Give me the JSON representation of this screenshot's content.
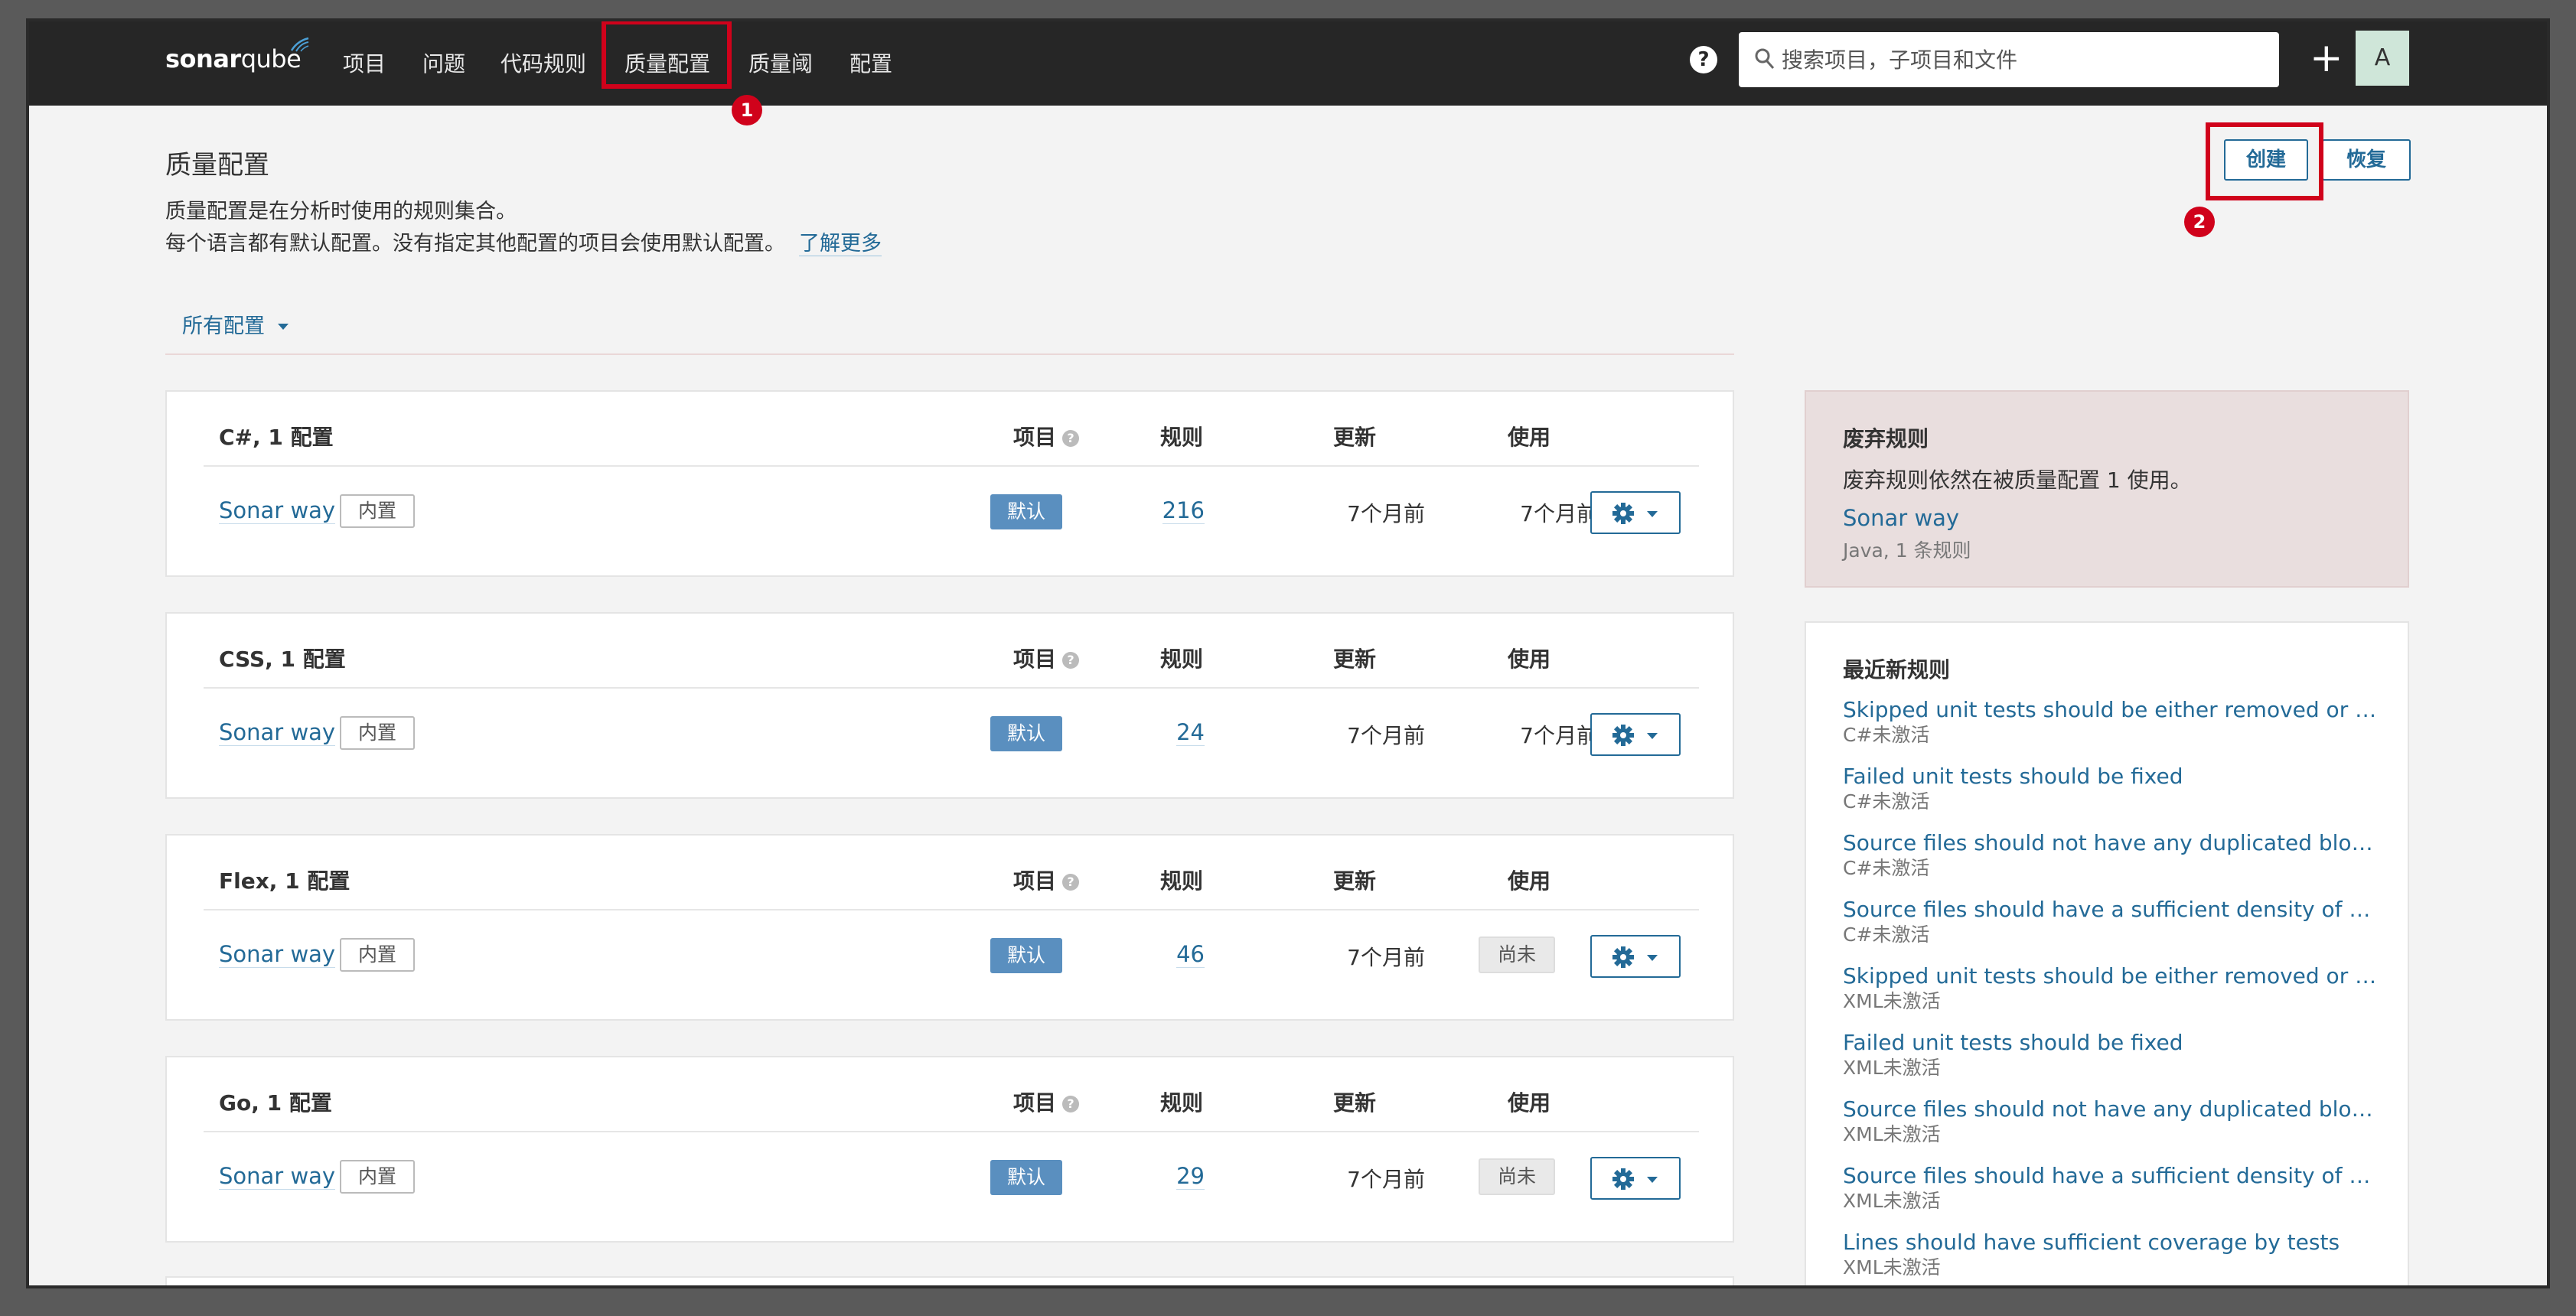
{
  "nav": {
    "logo_bold": "sonar",
    "logo_rest": "qube",
    "items": [
      "项目",
      "问题",
      "代码规则",
      "质量配置",
      "质量阈",
      "配置"
    ],
    "badge_1": "1",
    "help": "?",
    "search_placeholder": "搜索项目，子项目和文件",
    "plus": "+",
    "avatar": "A"
  },
  "header": {
    "title": "质量配置",
    "desc_line1": "质量配置是在分析时使用的规则集合。",
    "desc_line2": "每个语言都有默认配置。没有指定其他配置的项目会使用默认配置。",
    "learn_more": "了解更多",
    "create": "创建",
    "restore": "恢复",
    "badge_2": "2",
    "filter": "所有配置"
  },
  "columns": {
    "projects": "项目",
    "rules": "规则",
    "updated": "更新",
    "used": "使用"
  },
  "profiles": [
    {
      "lang": "C#, 1 配置",
      "name": "Sonar way",
      "builtin": "内置",
      "default": "默认",
      "rules": "216",
      "updated": "7个月前",
      "used": "7个月前",
      "used_tag": false
    },
    {
      "lang": "CSS, 1 配置",
      "name": "Sonar way",
      "builtin": "内置",
      "default": "默认",
      "rules": "24",
      "updated": "7个月前",
      "used": "7个月前",
      "used_tag": false
    },
    {
      "lang": "Flex, 1 配置",
      "name": "Sonar way",
      "builtin": "内置",
      "default": "默认",
      "rules": "46",
      "updated": "7个月前",
      "used": "尚未",
      "used_tag": true
    },
    {
      "lang": "Go, 1 配置",
      "name": "Sonar way",
      "builtin": "内置",
      "default": "默认",
      "rules": "29",
      "updated": "7个月前",
      "used": "尚未",
      "used_tag": true
    }
  ],
  "deprecated": {
    "title": "废弃规则",
    "desc": "废弃规则依然在被质量配置 1 使用。",
    "profile": "Sonar way",
    "sub": "Java, 1 条规则"
  },
  "recent": {
    "title": "最近新规则",
    "items": [
      {
        "rule": "Skipped unit tests should be either removed or fixed",
        "lang": "C#未激活"
      },
      {
        "rule": "Failed unit tests should be fixed",
        "lang": "C#未激活"
      },
      {
        "rule": "Source files should not have any duplicated blocks",
        "lang": "C#未激活"
      },
      {
        "rule": "Source files should have a sufficient density of comment lines",
        "lang": "C#未激活"
      },
      {
        "rule": "Skipped unit tests should be either removed or fixed",
        "lang": "XML未激活"
      },
      {
        "rule": "Failed unit tests should be fixed",
        "lang": "XML未激活"
      },
      {
        "rule": "Source files should not have any duplicated blocks",
        "lang": "XML未激活"
      },
      {
        "rule": "Source files should have a sufficient density of comment lines",
        "lang": "XML未激活"
      },
      {
        "rule": "Lines should have sufficient coverage by tests",
        "lang": "XML未激活"
      }
    ]
  },
  "colors": {
    "nav_bg": "#262626",
    "accent": "#236a97",
    "highlight": "#d0021b",
    "default_tag": "#5a8fbf"
  }
}
